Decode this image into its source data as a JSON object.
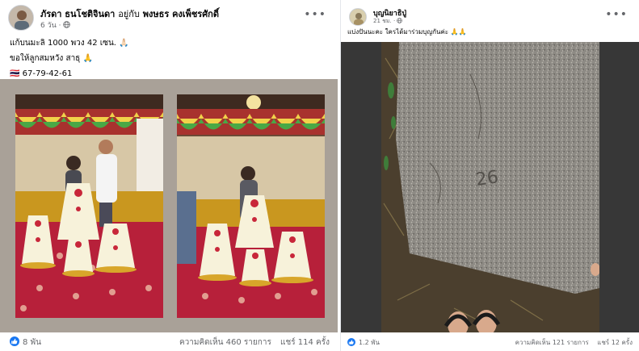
{
  "left_post": {
    "author": "ภัรดา ธนโชติจินดา",
    "with_text": "อยู่กับ",
    "tagged": "พงษธร คงเพ็ชรศักดิ์",
    "time": "6 วัน",
    "privacy_icon": "globe-icon",
    "caption_line1": "แก้บนมะลิ 1000 พวง 42 เซน. 🙏🏻",
    "caption_line2": "ขอให้ลูกสมหวัง สาธุ 🙏",
    "caption_line3": "🇹🇭 67-79-42-61",
    "reactions_count": "8 พัน",
    "comments": "ความคิดเห็น 460 รายการ",
    "shares": "แชร์ 114 ครั้ง"
  },
  "right_post": {
    "author": "บุญนิยาธิปู่",
    "time": "21 ชม.",
    "privacy_icon": "globe-icon",
    "caption": "แบ่งปันนะคะ ใครได้มาร่วมบุญกันค่ะ 🙏🙏",
    "reactions_count": "1.2 พัน",
    "comments": "ความคิดเห็น 121 รายการ",
    "shares": "แชร์ 12 ครั้ง"
  },
  "stone_writing": "26",
  "colors": {
    "facebook_blue": "#1877f2",
    "meta_grey": "#65676b",
    "photo_border": "#a9a198",
    "temple_carpet": "#b7203a"
  }
}
